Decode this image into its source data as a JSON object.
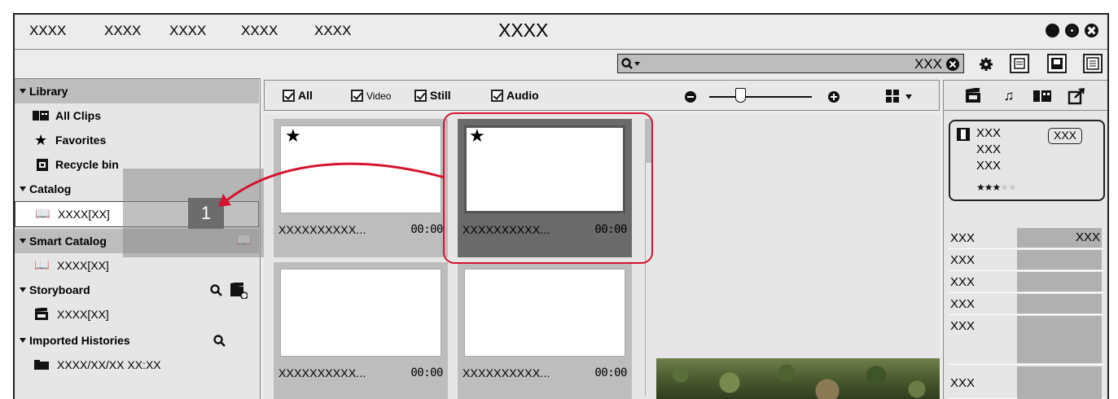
{
  "app": {
    "title": "XXXX",
    "menu": [
      "XXXX",
      "XXXX",
      "XXXX",
      "XXXX",
      "XXXX"
    ]
  },
  "toolbar": {
    "search": {
      "value": "XXX"
    }
  },
  "library": {
    "header": "Library",
    "items": [
      {
        "label": "All Clips",
        "icon": "all-clips-icon"
      },
      {
        "label": "Favorites",
        "icon": "star-icon"
      },
      {
        "label": "Recycle bin",
        "icon": "recycle-bin-icon"
      }
    ],
    "catalog": {
      "header": "Catalog",
      "item": "XXXX[XX]"
    },
    "smart_catalog": {
      "header": "Smart Catalog",
      "item": "XXXX[XX]"
    },
    "storyboard": {
      "header": "Storyboard",
      "item": "XXXX[XX]"
    },
    "imported_histories": {
      "header": "Imported Histories",
      "item": "XXXX/XX/XX XX:XX"
    },
    "drag_count": "1"
  },
  "filters": {
    "all": "All",
    "video": "Video",
    "still": "Still",
    "audio": "Audio"
  },
  "clips": [
    {
      "name": "XXXXXXXXXX...",
      "duration": "00:00",
      "favorite": true,
      "selected": false
    },
    {
      "name": "XXXXXXXXXX...",
      "duration": "00:00",
      "favorite": true,
      "selected": true
    },
    {
      "name": "XXXXXXXXXX...",
      "duration": "00:00",
      "favorite": false,
      "selected": false
    },
    {
      "name": "XXXXXXXXXX...",
      "duration": "00:00",
      "favorite": false,
      "selected": false
    }
  ],
  "properties": {
    "info": {
      "line1": "XXX",
      "line2": "XXX",
      "line3": "XXX",
      "badge": "XXX",
      "rating": 3,
      "rating_max": 5
    },
    "rows": [
      {
        "key": "XXX",
        "value": "XXX"
      },
      {
        "key": "XXX",
        "value": ""
      },
      {
        "key": "XXX",
        "value": ""
      },
      {
        "key": "XXX",
        "value": ""
      },
      {
        "key": "XXX",
        "value": ""
      },
      {
        "key": "XXX",
        "value": ""
      }
    ]
  },
  "colors": {
    "highlight": "#d5142e",
    "selected_clip": "#6a6a6a",
    "panel_header": "#bdbdbd"
  }
}
